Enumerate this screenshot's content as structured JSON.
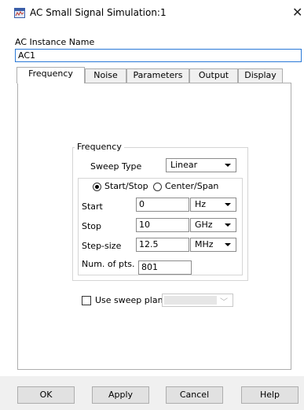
{
  "window": {
    "title": "AC Small Signal Simulation:1",
    "app_icon": "simulation-app-icon",
    "close_icon": "close-icon"
  },
  "instance": {
    "label": "AC Instance Name",
    "value": "AC1"
  },
  "tabs": [
    {
      "label": "Frequency",
      "active": true
    },
    {
      "label": "Noise",
      "active": false
    },
    {
      "label": "Parameters",
      "active": false
    },
    {
      "label": "Output",
      "active": false
    },
    {
      "label": "Display",
      "active": false
    }
  ],
  "frequency": {
    "group_label": "Frequency",
    "sweep_type_label": "Sweep Type",
    "sweep_type_value": "Linear",
    "mode_options": [
      {
        "label": "Start/Stop",
        "selected": true
      },
      {
        "label": "Center/Span",
        "selected": false
      }
    ],
    "rows": [
      {
        "label": "Start",
        "value": "0",
        "unit": "Hz"
      },
      {
        "label": "Stop",
        "value": "10",
        "unit": "GHz"
      },
      {
        "label": "Step-size",
        "value": "12.5",
        "unit": "MHz"
      }
    ],
    "num_pts_label": "Num. of pts.",
    "num_pts_value": "801"
  },
  "sweep_plan": {
    "label": "Use sweep plan",
    "checked": false,
    "value": ""
  },
  "buttons": {
    "ok": "OK",
    "apply": "Apply",
    "cancel": "Cancel",
    "help": "Help"
  }
}
